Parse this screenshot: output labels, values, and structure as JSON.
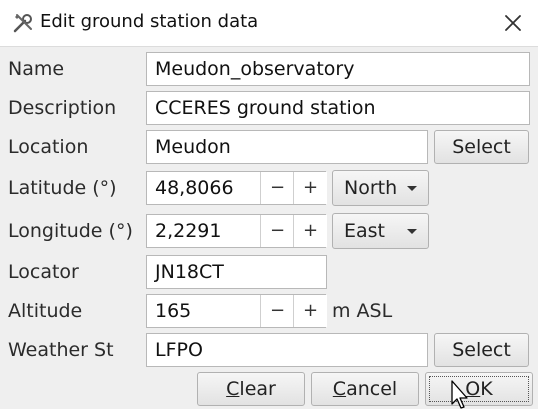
{
  "window": {
    "title": "Edit ground station data",
    "icon": "tools-icon",
    "close_icon": "close-icon"
  },
  "form": {
    "name": {
      "label": "Name",
      "value": "Meudon_observatory"
    },
    "description": {
      "label": "Description",
      "value": "CCERES ground station"
    },
    "location": {
      "label": "Location",
      "value": "Meudon",
      "button": "Select"
    },
    "latitude": {
      "label": "Latitude (°)",
      "value": "48,8066",
      "minus": "−",
      "plus": "+",
      "hemisphere": "North"
    },
    "longitude": {
      "label": "Longitude (°)",
      "value": "2,2291",
      "minus": "−",
      "plus": "+",
      "hemisphere": "East"
    },
    "locator": {
      "label": "Locator",
      "value": "JN18CT"
    },
    "altitude": {
      "label": "Altitude",
      "value": "165",
      "minus": "−",
      "plus": "+",
      "unit": "m ASL"
    },
    "weather": {
      "label": "Weather St",
      "value": "LFPO",
      "button": "Select"
    }
  },
  "buttons": {
    "clear": {
      "mnemonic": "C",
      "rest": "lear"
    },
    "cancel": {
      "mnemonic": "C",
      "rest": "ancel"
    },
    "ok": {
      "mnemonic": "O",
      "rest": "K"
    }
  }
}
